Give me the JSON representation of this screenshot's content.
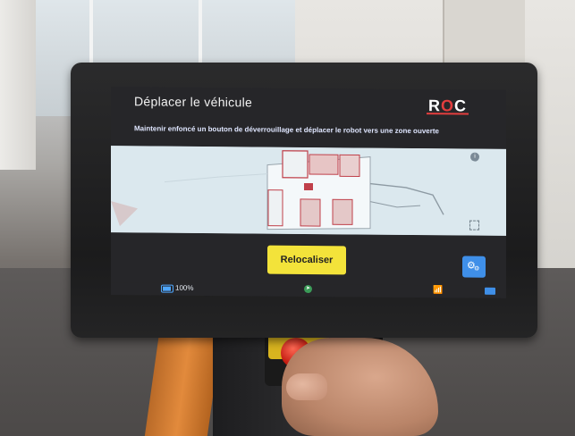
{
  "screen": {
    "title": "Déplacer le véhicule",
    "logo": {
      "left": "R",
      "middle": "O",
      "right": "C"
    },
    "instruction": "Maintenir enfoncé un bouton de déverrouillage et déplacer le robot vers une zone ouverte",
    "map": {
      "info_icon": "info-icon",
      "fullscreen_icon": "fullscreen-icon"
    },
    "primary_action": {
      "label": "Relocaliser",
      "color": "#f3e33a"
    },
    "settings_button": {
      "icon": "gears-icon",
      "color": "#3f8fe8"
    }
  },
  "statusbar": {
    "battery": {
      "icon": "battery-icon",
      "label": "100%"
    },
    "navigation_icon": "navigation-icon",
    "wifi_icon": "wifi-icon",
    "keyboard_icon": "keyboard-icon"
  },
  "colors": {
    "accent": "#e33e3e",
    "button": "#f3e33a",
    "blue": "#3f8fe8"
  }
}
